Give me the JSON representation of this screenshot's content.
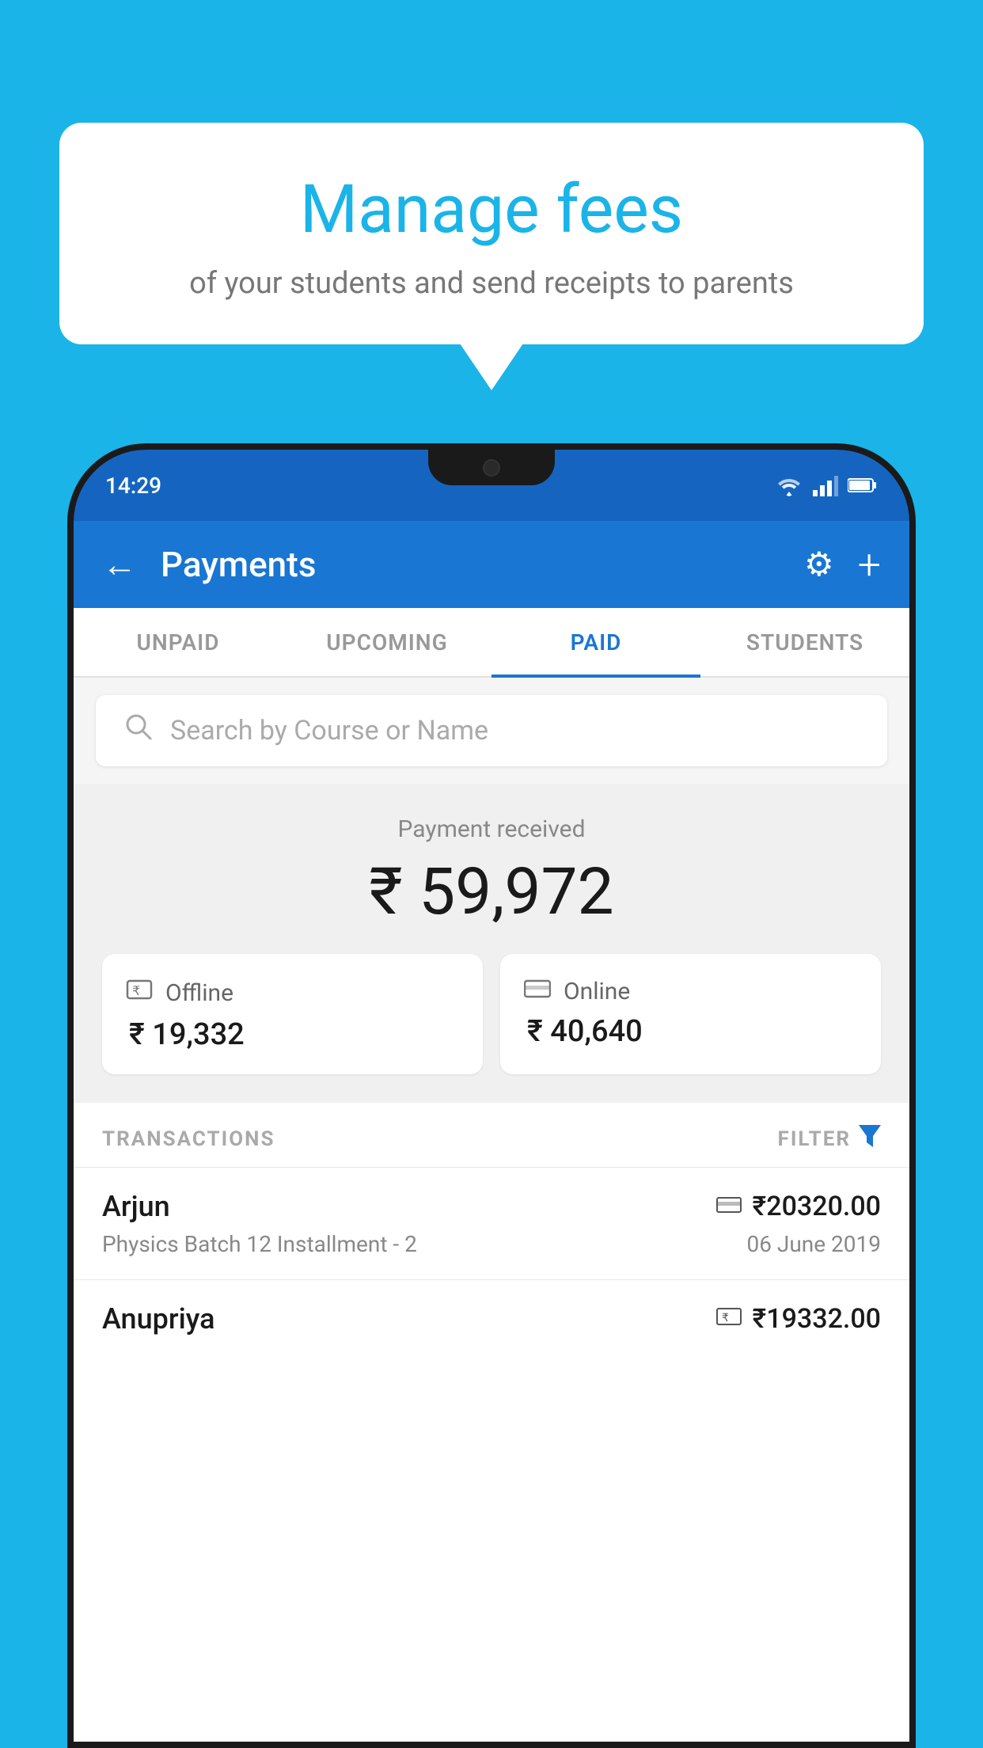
{
  "background_color": "#1ab4e8",
  "speech_bubble": {
    "title": "Manage fees",
    "subtitle": "of your students and send receipts to parents"
  },
  "status_bar": {
    "time": "14:29",
    "icons": [
      "wifi",
      "signal",
      "battery"
    ]
  },
  "app_bar": {
    "title": "Payments",
    "back_icon": "←",
    "settings_icon": "⚙",
    "add_icon": "+"
  },
  "tabs": [
    {
      "label": "UNPAID",
      "active": false
    },
    {
      "label": "UPCOMING",
      "active": false
    },
    {
      "label": "PAID",
      "active": true
    },
    {
      "label": "STUDENTS",
      "active": false
    }
  ],
  "search": {
    "placeholder": "Search by Course or Name"
  },
  "payment_received": {
    "label": "Payment received",
    "amount": "₹ 59,972",
    "offline": {
      "label": "Offline",
      "amount": "₹ 19,332"
    },
    "online": {
      "label": "Online",
      "amount": "₹ 40,640"
    }
  },
  "transactions": {
    "header": "TRANSACTIONS",
    "filter_label": "FILTER",
    "rows": [
      {
        "name": "Arjun",
        "amount": "₹20320.00",
        "course": "Physics Batch 12 Installment - 2",
        "date": "06 June 2019",
        "payment_type": "card"
      },
      {
        "name": "Anupriya",
        "amount": "₹19332.00",
        "course": "",
        "date": "",
        "payment_type": "cash"
      }
    ]
  }
}
